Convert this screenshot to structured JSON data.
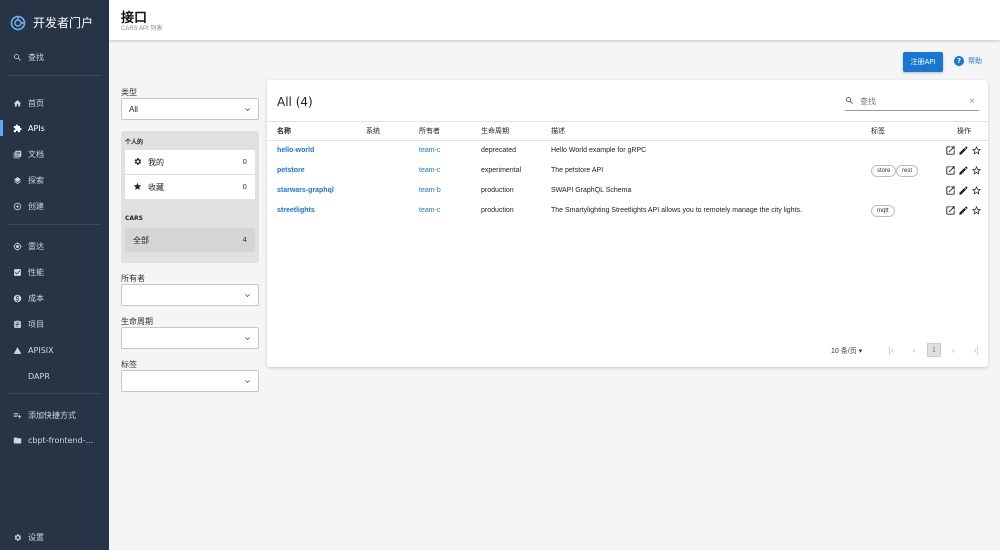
{
  "brand": {
    "title": "开发者门户"
  },
  "sidebar": {
    "search_label": "查找",
    "items": [
      {
        "label": "首页",
        "icon": "home-icon"
      },
      {
        "label": "APIs",
        "icon": "puzzle-icon",
        "active": true
      },
      {
        "label": "文档",
        "icon": "docs-icon"
      },
      {
        "label": "探索",
        "icon": "layers-icon"
      },
      {
        "label": "创建",
        "icon": "add-circle-icon"
      },
      {
        "label": "雷达",
        "icon": "radar-icon"
      },
      {
        "label": "性能",
        "icon": "score-icon"
      },
      {
        "label": "成本",
        "icon": "cost-icon"
      },
      {
        "label": "项目",
        "icon": "assignment-icon"
      },
      {
        "label": "APISIX",
        "icon": "apisix-icon"
      },
      {
        "label": "DAPR",
        "icon": ""
      },
      {
        "label": "添加快捷方式",
        "icon": "playlist-add-icon"
      },
      {
        "label": "cbpt-frontend-...",
        "icon": "shortcut-icon"
      }
    ],
    "settings_label": "设置"
  },
  "header": {
    "title": "接口",
    "subtitle": "CARS API 列表"
  },
  "actions": {
    "register_label": "注册API",
    "help_label": "帮助"
  },
  "filters": {
    "type_label": "类型",
    "type_value": "All",
    "personal_heading": "个人的",
    "personal_items": [
      {
        "label": "我的",
        "count": "0",
        "icon": "gear-icon"
      },
      {
        "label": "收藏",
        "count": "0",
        "icon": "star-icon"
      }
    ],
    "org_heading": "CARS",
    "org_items": [
      {
        "label": "全部",
        "count": "4"
      }
    ],
    "owner_label": "所有者",
    "lifecycle_label": "生命周期",
    "tags_label": "标签"
  },
  "table": {
    "title": "All (4)",
    "search_placeholder": "查找",
    "headers": {
      "name": "名称",
      "system": "系统",
      "owner": "所有者",
      "lifecycle": "生命周期",
      "description": "描述",
      "tags": "标签",
      "actions": "操作"
    },
    "rows": [
      {
        "name": "hello-world",
        "system": "",
        "owner": "team-c",
        "lifecycle": "deprecated",
        "description": "Hello World example for gRPC",
        "tags": []
      },
      {
        "name": "petstore",
        "system": "",
        "owner": "team-c",
        "lifecycle": "experimental",
        "description": "The petstore API",
        "tags": [
          "store",
          "rest"
        ]
      },
      {
        "name": "starwars-graphql",
        "system": "",
        "owner": "team-b",
        "lifecycle": "production",
        "description": "SWAPI GraphQL Schema",
        "tags": []
      },
      {
        "name": "streetlights",
        "system": "",
        "owner": "team-c",
        "lifecycle": "production",
        "description": "The Smartylighting Streetlights API allows you to remotely manage the city lights.",
        "tags": [
          "mqtt"
        ]
      }
    ],
    "pagination": {
      "rows_per_page": "10 条/页",
      "current_page": "1"
    }
  },
  "colors": {
    "sidebar_bg": "#263446",
    "accent": "#1976d2"
  }
}
